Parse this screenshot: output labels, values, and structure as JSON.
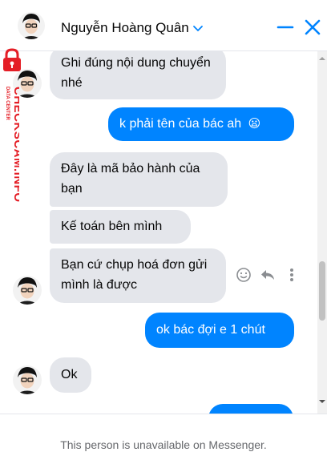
{
  "header": {
    "contact_name": "Nguyễn Hoàng Quân",
    "dropdown_icon": "chevron-down-icon",
    "minimize_icon": "minimize-icon",
    "close_icon": "close-icon",
    "accent_color": "#0084ff"
  },
  "watermark": {
    "vertical_text": "CHECKSCAM.INFO",
    "sub_text": "DATA CENTER",
    "color": "#e41e26"
  },
  "messages": [
    {
      "direction": "incoming",
      "text": "Ghi đúng nội dung chuyển nhé"
    },
    {
      "direction": "outgoing",
      "text": "k phải tên của bác ah",
      "emoji": "😦"
    },
    {
      "direction": "incoming",
      "text": "Đây là mã bảo hành của bạn"
    },
    {
      "direction": "incoming",
      "text": "Kế toán bên mình"
    },
    {
      "direction": "incoming",
      "text": "Bạn cứ chụp hoá đơn gửi mình là được"
    },
    {
      "direction": "outgoing",
      "text": "ok bác đợi e 1 chút"
    },
    {
      "direction": "incoming",
      "text": "Ok"
    }
  ],
  "message_actions": [
    "react-icon",
    "reply-icon",
    "more-icon"
  ],
  "footer": {
    "notice": "This person is unavailable on Messenger."
  }
}
